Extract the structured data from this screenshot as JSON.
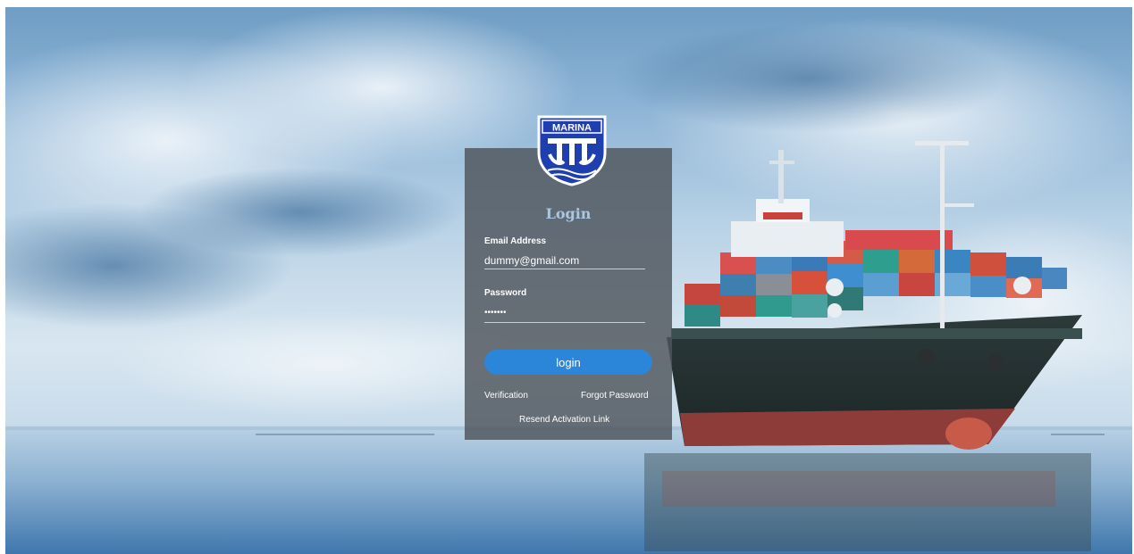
{
  "brand": {
    "logo_text": "MARINA"
  },
  "login": {
    "title": "Login",
    "email_label": "Email Address",
    "email_value": "dummy@gmail.com",
    "password_label": "Password",
    "password_value": "dummy12",
    "submit_label": "login",
    "verification_link": "Verification",
    "forgot_password_link": "Forgot Password",
    "resend_link": "Resend Activation Link"
  },
  "colors": {
    "panel": "#4e545c",
    "button": "#2b85d8",
    "title": "#a9c7e4",
    "logo_blue": "#1f3fae"
  }
}
